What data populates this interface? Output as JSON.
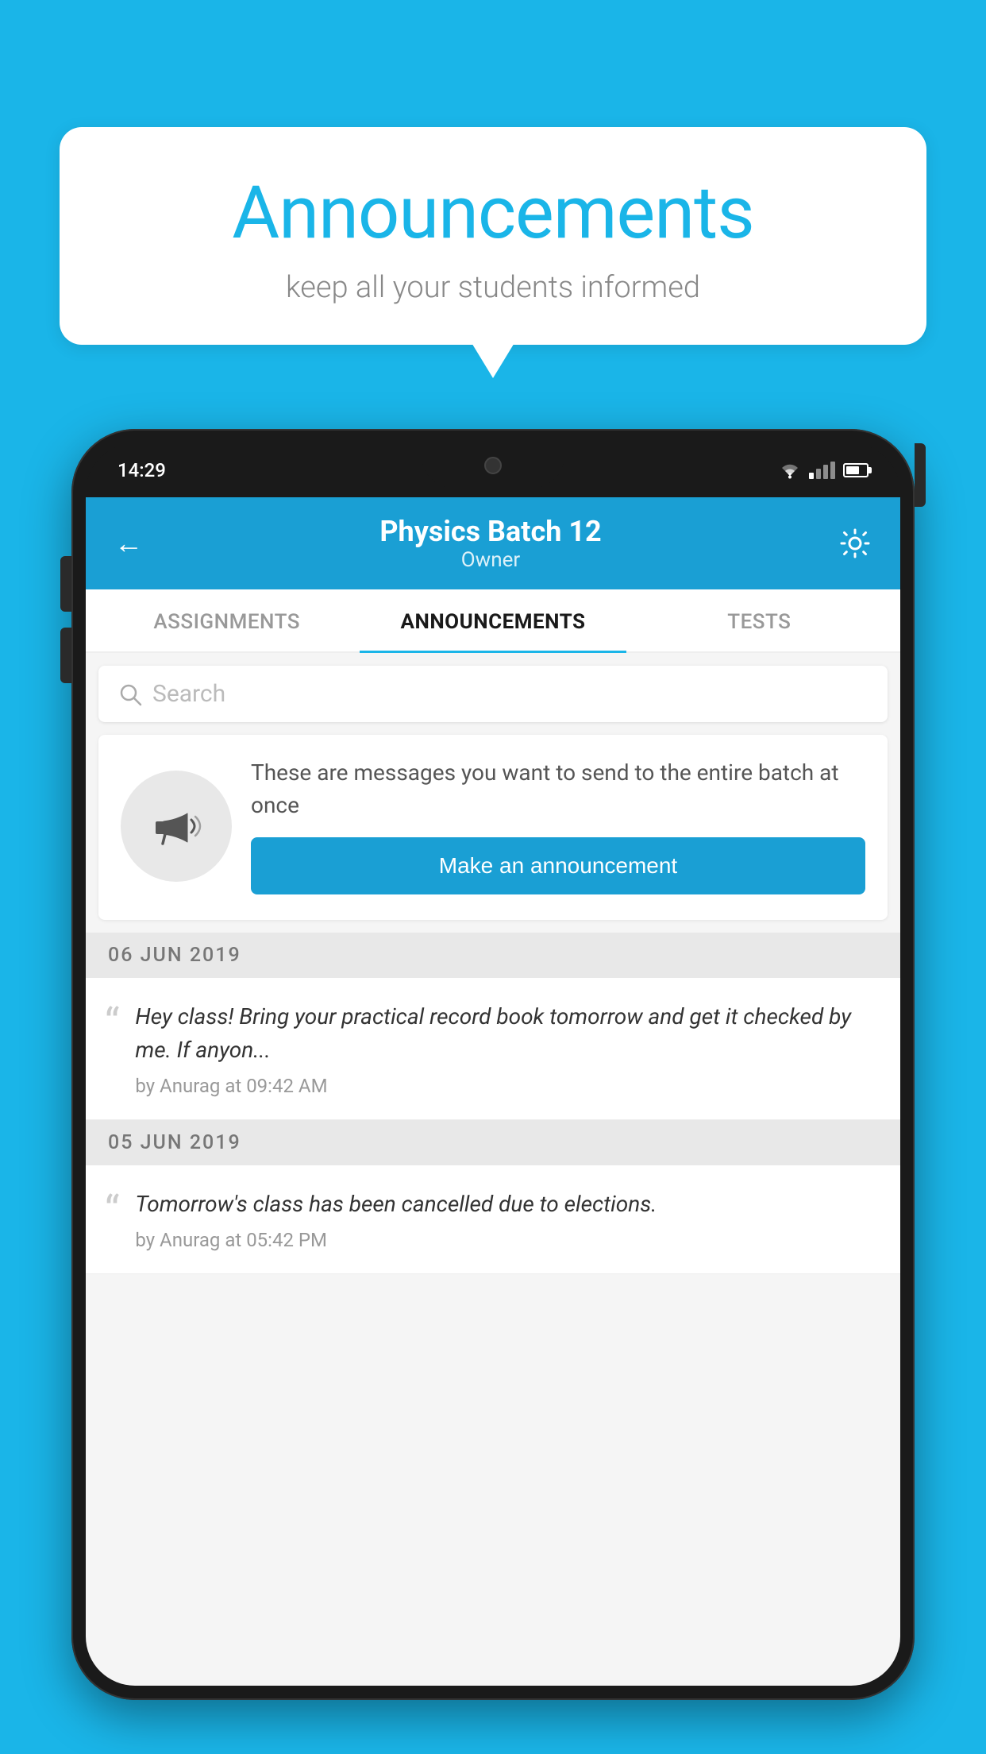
{
  "background_color": "#1ab5e8",
  "speech_bubble": {
    "title": "Announcements",
    "subtitle": "keep all your students informed"
  },
  "phone": {
    "status_bar": {
      "time": "14:29"
    },
    "header": {
      "title": "Physics Batch 12",
      "subtitle": "Owner",
      "back_label": "←"
    },
    "tabs": [
      {
        "label": "ASSIGNMENTS",
        "active": false
      },
      {
        "label": "ANNOUNCEMENTS",
        "active": true
      },
      {
        "label": "TESTS",
        "active": false
      }
    ],
    "search": {
      "placeholder": "Search"
    },
    "promo": {
      "description_text": "These are messages you want to send to the entire batch at once",
      "button_label": "Make an announcement"
    },
    "announcements": [
      {
        "date": "06  JUN  2019",
        "text": "Hey class! Bring your practical record book tomorrow and get it checked by me. If anyon...",
        "meta": "by Anurag at 09:42 AM"
      },
      {
        "date": "05  JUN  2019",
        "text": "Tomorrow's class has been cancelled due to elections.",
        "meta": "by Anurag at 05:42 PM"
      }
    ]
  }
}
